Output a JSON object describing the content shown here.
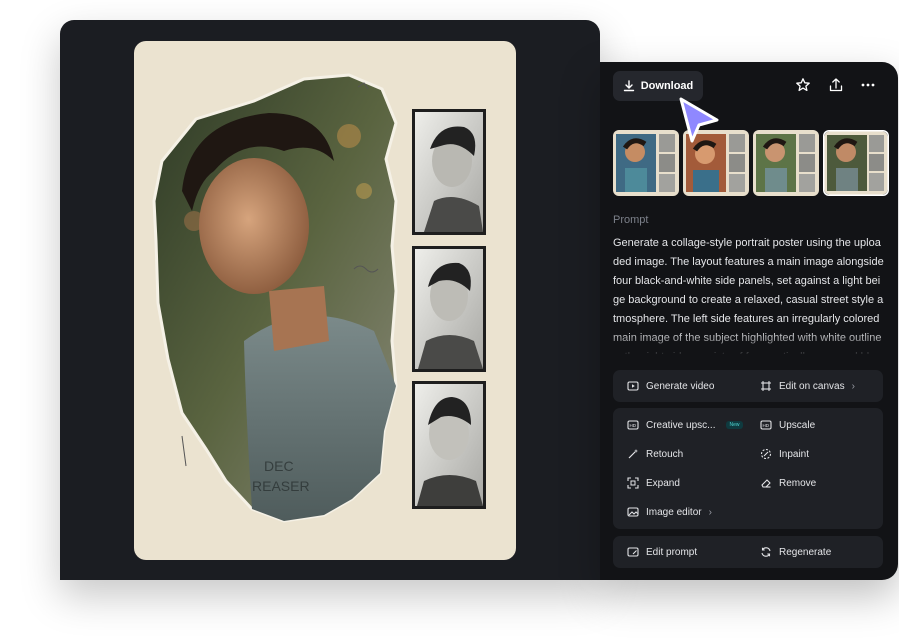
{
  "toolbar": {
    "download_label": "Download",
    "icons": [
      "download-icon",
      "star-icon",
      "share-icon",
      "more-icon"
    ]
  },
  "thumbnails": [
    {
      "name": "variant-1",
      "selected": false
    },
    {
      "name": "variant-2",
      "selected": false
    },
    {
      "name": "variant-3",
      "selected": false
    },
    {
      "name": "variant-4",
      "selected": true
    }
  ],
  "prompt": {
    "title": "Prompt",
    "text": "Generate a collage-style portrait poster using the uploaded image. The layout features a main image alongside four black-and-white side panels, set against a light beige background to create a relaxed, casual street style atmosphere. The left side features an irregularly colored main image of the subject highlighted with white outlines; the right side consists of four vertically arranged black-and-"
  },
  "actions": {
    "generate_video": "Generate video",
    "edit_on_canvas": "Edit on canvas",
    "creative_upscale": "Creative upsc...",
    "new_badge": "New",
    "upscale": "Upscale",
    "retouch": "Retouch",
    "inpaint": "Inpaint",
    "expand": "Expand",
    "remove": "Remove",
    "image_editor": "Image editor",
    "edit_prompt": "Edit prompt",
    "regenerate": "Regenerate"
  },
  "colors": {
    "main_background": "#1b1d22",
    "panel_background": "#121316",
    "action_group_background": "#1f2126",
    "poster_beige": "#ebe3d0",
    "cursor_accent": "#8f88ff"
  }
}
